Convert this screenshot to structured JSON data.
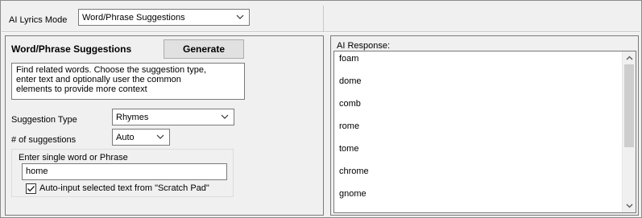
{
  "top": {
    "mode_label": "AI Lyrics Mode",
    "mode_value": "Word/Phrase Suggestions"
  },
  "left": {
    "title": "Word/Phrase Suggestions",
    "generate_label": "Generate",
    "description_lines": [
      "Find related words. Choose the suggestion type,",
      "enter text and optionally user the common",
      "elements to provide more context"
    ],
    "suggestion_type_label": "Suggestion Type",
    "suggestion_type_value": "Rhymes",
    "num_label": "# of suggestions",
    "num_value": "Auto",
    "group_title": "Enter single word or Phrase",
    "input_value": "home",
    "checkbox_label": "Auto-input selected text from \"Scratch Pad\"",
    "checkbox_checked": true
  },
  "right": {
    "response_label": "AI Response:",
    "items": [
      "foam",
      "dome",
      "comb",
      "rome",
      "tome",
      "chrome",
      "gnome"
    ]
  },
  "icons": {
    "dropdown": "chevron-down-icon",
    "scroll_up": "chevron-up-icon",
    "scroll_down": "chevron-down-icon",
    "check": "checkmark-icon"
  }
}
